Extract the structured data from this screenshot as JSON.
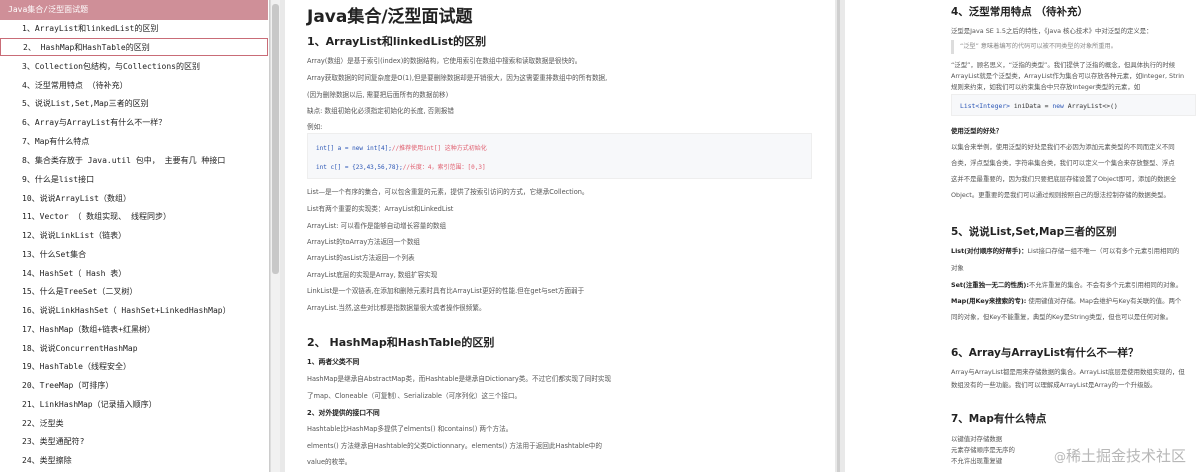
{
  "toc": {
    "title": "Java集合/泛型面试题",
    "items": [
      "1、ArrayList和linkedList的区别",
      "2、 HashMap和HashTable的区别",
      "3、Collection包结构，与Collections的区别",
      "4、泛型常用特点 （待补充）",
      "5、说说List,Set,Map三者的区别",
      "6、Array与ArrayList有什么不一样？",
      "7、Map有什么特点",
      "8、集合类存放于 Java.util 包中， 主要有几 种接口",
      "9、什么是list接口",
      "10、说说ArrayList（数组）",
      "11、Vector （ 数组实现、 线程同步）",
      "12、说说LinkList（链表）",
      "13、什么Set集合",
      "14、HashSet（ Hash 表）",
      "15、什么是TreeSet（二叉树）",
      "16、说说LinkHashSet（ HashSet+LinkedHashMap）",
      "17、HashMap（数组+链表+红黑树）",
      "18、说说ConcurrentHashMap",
      "19、HashTable（线程安全）",
      "20、TreeMap（可排序）",
      "21、LinkHashMap（记录插入顺序）",
      "22、泛型类",
      "23、类型通配符?",
      "24、类型擦除"
    ]
  },
  "mid": {
    "title": "Java集合/泛型面试题",
    "sec1": "1、ArrayList和linkedList的区别",
    "p1": "Array(数组）是基于索引(index)的数据结构，它使用索引在数组中搜索和读取数据是很快的。",
    "p2": "Array获取数据的时间复杂度是O(1),但是要删除数据却是开销很大，因为这需要重排数组中的所有数据,",
    "p3": "(因为删除数据以后, 需要把后面所有的数据前移)",
    "p4": "缺点: 数组初始化必须指定初始化的长度, 否则报错",
    "p5": "例如:",
    "code1_kw": "int[] a = new int[4];",
    "code1_cm": "//推荐使用int[] 这种方式初始化",
    "code2_kw": "int c[] = {23,43,56,78};",
    "code2_cm": "//长度：4，索引范围：[0,3]",
    "p6": "List—是一个有序的集合，可以包含重复的元素，提供了按索引访问的方式，它继承Collection。",
    "p7": "List有两个重要的实现类：ArrayList和LinkedList",
    "p8": "ArrayList: 可以看作是能够自动增长容量的数组",
    "p9": "ArrayList的toArray方法返回一个数组",
    "p10": "ArrayList的asList方法返回一个列表",
    "p11": "ArrayList底层的实现是Array, 数组扩容实现",
    "p12": "LinkList是一个双链表,在添加和删除元素时具有比ArrayList更好的性能.但在get与set方面弱于",
    "p13": "ArrayList.当然,这些对比都是指数据量很大或者操作很频繁。",
    "sec2": "2、 HashMap和HashTable的区别",
    "s21": "1、两者父类不同",
    "p14": "HashMap是继承自AbstractMap类，而Hashtable是继承自Dictionary类。不过它们都实现了同时实现",
    "p15": "了map、Cloneable（可复制）、Serializable（可序列化）这三个接口。",
    "s22": "2、对外提供的接口不同",
    "p16": "Hashtable比HashMap多提供了elments() 和contains() 两个方法。",
    "p17": "elments() 方法继承自Hashtable的父类Dictionnary。elements() 方法用于返回此Hashtable中的",
    "p18": "value的枚举。"
  },
  "right": {
    "sec4": "4、泛型常用特点 （待补充）",
    "r1": "泛型是Java SE 1.5之后的特性，《Java 核心技术》中对泛型的定义是：",
    "quote": "“泛型” 意味着编写的代码可以被不同类型的对象所重用。",
    "r2": "“泛型”，顾名思义，“泛指的类型”。我们提供了泛指的概念，但具体执行的时候",
    "r3": "ArrayList就是个泛型类，ArrayList作为集合可以存放各种元素，如Integer, Strin",
    "r4": "规则来约束，如我们可以约束集合中只存放Integer类型的元素，如",
    "code_a": "List<Integer>",
    "code_b": " iniData = ",
    "code_c": "new",
    "code_d": " ArrayList<>()",
    "r5": "使用泛型的好处？",
    "r6": "以集合来举例，使用泛型的好处是我们不必因为添加元素类型的不同而定义不同",
    "r7": "合类，浮点型集合类，字符串集合类，我们可以定义一个集合来存放整型、浮点",
    "r8": "这并不是最重要的，因为我们只要把底层存储设置了Object即可，添加的数据全",
    "r9": "Object。更重要的是我们可以通过规则按照自己的想法控制存储的数据类型。",
    "sec5": "5、说说List,Set,Map三者的区别",
    "r10b": "List(对付顺序的好帮手)：",
    "r10": "List接口存储一组不唯一（可以有多个元素引用相同的",
    "r11": "对象",
    "r12b": "Set(注重独一无二的性质):",
    "r12": "不允许重复的集合。不会有多个元素引用相同的对象。",
    "r13b": "Map(用Key来搜索的专):",
    "r13": " 使用键值对存储。Map会维护与Key有关联的值。两个",
    "r14": "同的对象，但Key不能重复，典型的Key是String类型，但也可以是任何对象。",
    "sec6": "6、Array与ArrayList有什么不一样？",
    "r15": "Array与ArrayList都是用来存储数据的集合。ArrayList底层是使用数组实现的，但",
    "r16": "数组没有的一些功能。我们可以理解成ArrayList是Array的一个升级版。",
    "sec7": "7、Map有什么特点",
    "r17": "以键值对存储数据",
    "r18": "元素存储顺序是无序的",
    "r19": "不允许出现重复键"
  },
  "watermark": {
    "at": "@",
    "text": "稀土掘金技术社区"
  }
}
